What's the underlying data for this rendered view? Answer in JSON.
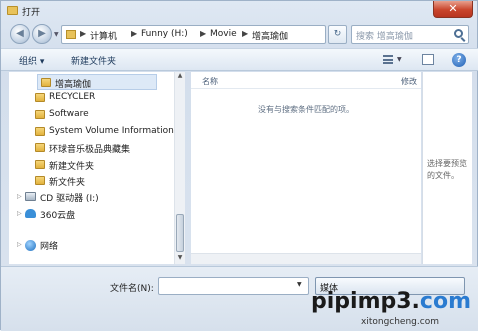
{
  "window": {
    "title": "打开",
    "close_label": "✕"
  },
  "nav": {
    "back_glyph": "◀",
    "forward_glyph": "▶",
    "breadcrumbs": [
      "计算机",
      "Funny (H:)",
      "Movie",
      "增高瑜伽"
    ],
    "refresh_glyph": "↻",
    "search_placeholder": "搜索 增高瑜伽"
  },
  "toolbar": {
    "organize_label": "组织 ▾",
    "new_folder_label": "新建文件夹",
    "help_glyph": "?"
  },
  "tree": [
    {
      "label": "增高瑜伽",
      "icon": "folder-icon",
      "selected": true
    },
    {
      "label": "RECYCLER",
      "icon": "folder-icon"
    },
    {
      "label": "Software",
      "icon": "folder-icon"
    },
    {
      "label": "System Volume Information",
      "icon": "folder-icon"
    },
    {
      "label": "环球音乐极品典藏集",
      "icon": "folder-icon"
    },
    {
      "label": "新建文件夹",
      "icon": "folder-icon"
    },
    {
      "label": "新文件夹",
      "icon": "folder-icon"
    },
    {
      "label": "CD 驱动器 (I:)",
      "icon": "drive-icon"
    },
    {
      "label": "360云盘",
      "icon": "cloud-icon"
    },
    {
      "label": "网络",
      "icon": "network-icon"
    }
  ],
  "content": {
    "columns": [
      "名称",
      "修改"
    ],
    "empty_message": "没有与搜索条件匹配的项。"
  },
  "preview": {
    "text": "选择要预览的文件。"
  },
  "bottom": {
    "filename_label": "文件名(N):",
    "filename_value": "",
    "filetype_value": "媒体"
  },
  "watermark": {
    "main_prefix": "pipimp3.",
    "main_suffix": "com",
    "sub": "xitongcheng.com"
  },
  "colors": {
    "accent": "#2a7bd0",
    "close": "#c9452c"
  }
}
